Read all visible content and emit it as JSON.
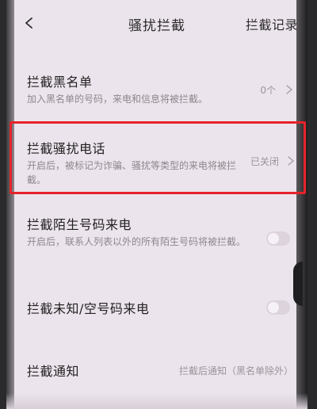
{
  "header": {
    "title": "骚扰拦截",
    "action_label": "拦截记录",
    "back_icon": "chevron-left-icon"
  },
  "settings": {
    "blacklist": {
      "title": "拦截黑名单",
      "subtitle": "加入黑名单的号码，来电和信息将被拦截。",
      "value": "0个"
    },
    "harassment_calls": {
      "title": "拦截骚扰电话",
      "subtitle": "开启后，被标记为诈骗、骚扰等类型的来电将被拦截。",
      "value": "已关闭",
      "highlight_color": "#e5242a"
    },
    "stranger_calls": {
      "title": "拦截陌生号码来电",
      "subtitle": "开启后，联系人列表以外的所有陌生号码将被拦截。",
      "enabled": false
    },
    "unknown_calls": {
      "title": "拦截未知/空号码来电",
      "enabled": false
    },
    "notification": {
      "title": "拦截通知",
      "value": "拦截后通知（黑名单除外）"
    }
  }
}
